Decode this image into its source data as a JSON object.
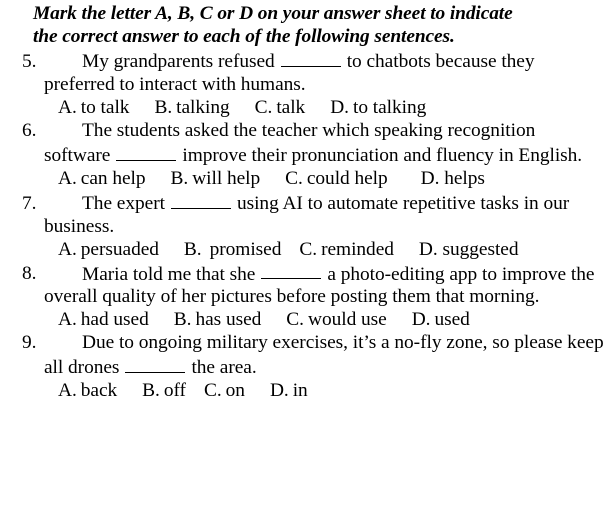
{
  "document": {
    "instruction": {
      "line1": "Mark the letter A, B, C or D on your answer sheet to indicate",
      "line2": "the correct answer to each of the following sentences."
    },
    "questions": [
      {
        "number": "5.",
        "stem_line1": "My grandparents refused",
        "stem_line1_after": "to chatbots because",
        "stem_line2": "they preferred to interact with humans.",
        "options": [
          {
            "letter": "A.",
            "text": "to talk"
          },
          {
            "letter": "B.",
            "text": "talking"
          },
          {
            "letter": "C.",
            "text": "talk"
          },
          {
            "letter": "D.",
            "text": "to talking"
          }
        ]
      },
      {
        "number": "6.",
        "stem_line1": "The students asked the teacher which speaking",
        "stem_line2": "recognition software",
        "stem_line2_after": "improve their pronunciation and",
        "stem_line3": "fluency in English.",
        "options": [
          {
            "letter": "A.",
            "text": "can help"
          },
          {
            "letter": "B.",
            "text": "will help"
          },
          {
            "letter": "C.",
            "text": "could help"
          },
          {
            "letter": "D.",
            "text": "helps"
          }
        ]
      },
      {
        "number": "7.",
        "stem_line1": "The expert",
        "stem_line1_after": "using AI to automate repetitive tasks",
        "stem_line2": "in our business.",
        "options": [
          {
            "letter": "A.",
            "text": "persuaded"
          },
          {
            "letter": "B.",
            "text": "promised"
          },
          {
            "letter": "C.",
            "text": "reminded"
          },
          {
            "letter": "D.",
            "text": "suggested"
          }
        ]
      },
      {
        "number": "8.",
        "stem_line1": "Maria told me that she",
        "stem_line1_after": "a photo-editing app to",
        "stem_line2": "improve the overall quality of her pictures before posting",
        "stem_line3": "them that morning.",
        "options": [
          {
            "letter": "A.",
            "text": "had used"
          },
          {
            "letter": "B.",
            "text": "has used"
          },
          {
            "letter": "C.",
            "text": "would use"
          },
          {
            "letter": "D.",
            "text": "used"
          }
        ]
      },
      {
        "number": "9.",
        "stem_line1": "Due to ongoing military exercises, it’s a no-fly zone, so",
        "stem_line2": "please keep all drones",
        "stem_line2_after": "the area.",
        "options": [
          {
            "letter": "A.",
            "text": "back"
          },
          {
            "letter": "B.",
            "text": "off"
          },
          {
            "letter": "C.",
            "text": "on"
          },
          {
            "letter": "D.",
            "text": "in"
          }
        ]
      }
    ]
  }
}
